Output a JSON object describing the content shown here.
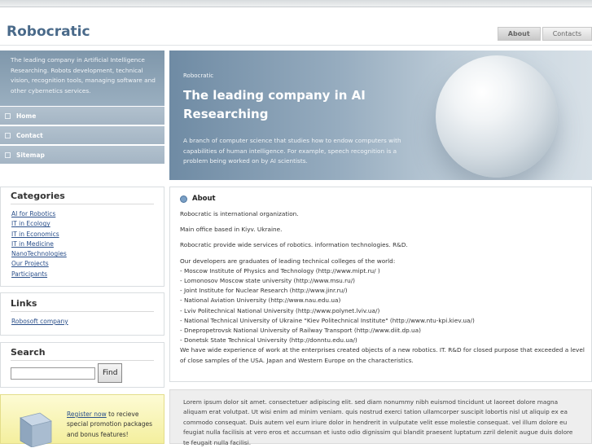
{
  "header": {
    "logo": "Robocratic",
    "tabs": [
      {
        "label": "About"
      },
      {
        "label": "Contacts"
      }
    ]
  },
  "sidebar": {
    "intro": "The leading company in Artificial Intelligence Researching. Robots development, technical vision, recognition tools, managing software and other cybernetics services.",
    "nav": [
      {
        "label": "Home"
      },
      {
        "label": "Contact"
      },
      {
        "label": "Sitemap"
      }
    ],
    "categories": {
      "title": "Categories",
      "items": [
        "AI for Robotics",
        "IT in Ecology",
        "IT in Economics",
        "IT in Medicine",
        "NanoTechnologies",
        "Our Projects",
        "Participants"
      ]
    },
    "links": {
      "title": "Links",
      "items": [
        "Robosoft company"
      ]
    },
    "search": {
      "title": "Search",
      "value": "",
      "button": "Find"
    },
    "promo": {
      "link": "Register now",
      "text": " to recieve special promotion packages and bonus features!"
    }
  },
  "banner": {
    "small": "Robocratic",
    "title": "The leading company in AI Researching",
    "description": "A branch of computer science that studies how to endow computers with capabilities of human intelligence. For example, speech recognition is a problem being worked on by AI scientists."
  },
  "about": {
    "heading": "About",
    "p1": "Robocratic is international organization.",
    "p2": "Main office based in Kiyv. Ukraine.",
    "p3": "Robocratic provide wide services of robotics. information technologies. R&D.",
    "dev_intro": "Our developers are graduates of leading technical colleges of the world:",
    "developers": [
      "- Moscow Institute of Physics and Technology (http://www.mipt.ru/ )",
      "- Lomonosov Moscow state university (http://www.msu.ru/)",
      "- Joint Institute for Nuclear Research (http://www.jinr.ru/)",
      "- National Aviation University (http://www.nau.edu.ua)",
      "- Lviv Politechnical National University (http://www.polynet.lviv.ua/)",
      "- National Technical University of Ukraine \"Kiev Politechnical Institute\" (http://www.ntu-kpi.kiev.ua/)",
      "- Dnepropetrovsk National University of Railway Transport (http://www.diit.dp.ua)",
      "- Donetsk State Technical University (http://donntu.edu.ua/)"
    ],
    "experience": "We have wide experience of work at the enterprises created objects of a new robotics. IT. R&D for closed purpose that exceeded a level of close samples of the USA. Japan and Western Europe on the characteristics."
  },
  "lorem": "Lorem ipsum dolor sit amet. consectetuer adipiscing elit. sed diam nonummy nibh euismod tincidunt ut laoreet dolore magna aliquam erat volutpat. Ut wisi enim ad minim veniam. quis nostrud exerci tation ullamcorper suscipit lobortis nisl ut aliquip ex ea commodo consequat. Duis autem vel eum iriure dolor in hendrerit in vulputate velit esse molestie consequat. vel illum dolore eu feugiat nulla facilisis at vero eros et accumsan et iusto odio dignissim qui blandit praesent luptatum zzril delenit augue duis dolore te feugait nulla facilisi."
}
